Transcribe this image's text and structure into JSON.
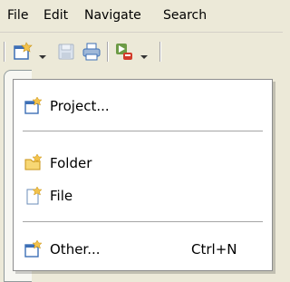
{
  "menubar": {
    "items": [
      "File",
      "Edit",
      "Navigate",
      "Search"
    ]
  },
  "toolbar": {
    "icons": [
      "new-wizard-icon",
      "dropdown-arrow-icon",
      "save-icon",
      "print-icon",
      "run-icon",
      "dropdown-arrow-icon"
    ]
  },
  "dropdown": {
    "items": [
      {
        "label": "Project...",
        "icon": "new-project-icon",
        "shortcut": ""
      },
      {
        "label": "Folder",
        "icon": "new-folder-icon",
        "shortcut": ""
      },
      {
        "label": "File",
        "icon": "new-file-icon",
        "shortcut": ""
      },
      {
        "label": "Other...",
        "icon": "new-other-icon",
        "shortcut": "Ctrl+N"
      }
    ]
  },
  "colors": {
    "chrome_bg": "#ece9d8",
    "menu_bg": "#ffffff",
    "separator": "#a5a5a5",
    "icon_blue": "#3d6fb6",
    "icon_yellow": "#f2c24c"
  }
}
